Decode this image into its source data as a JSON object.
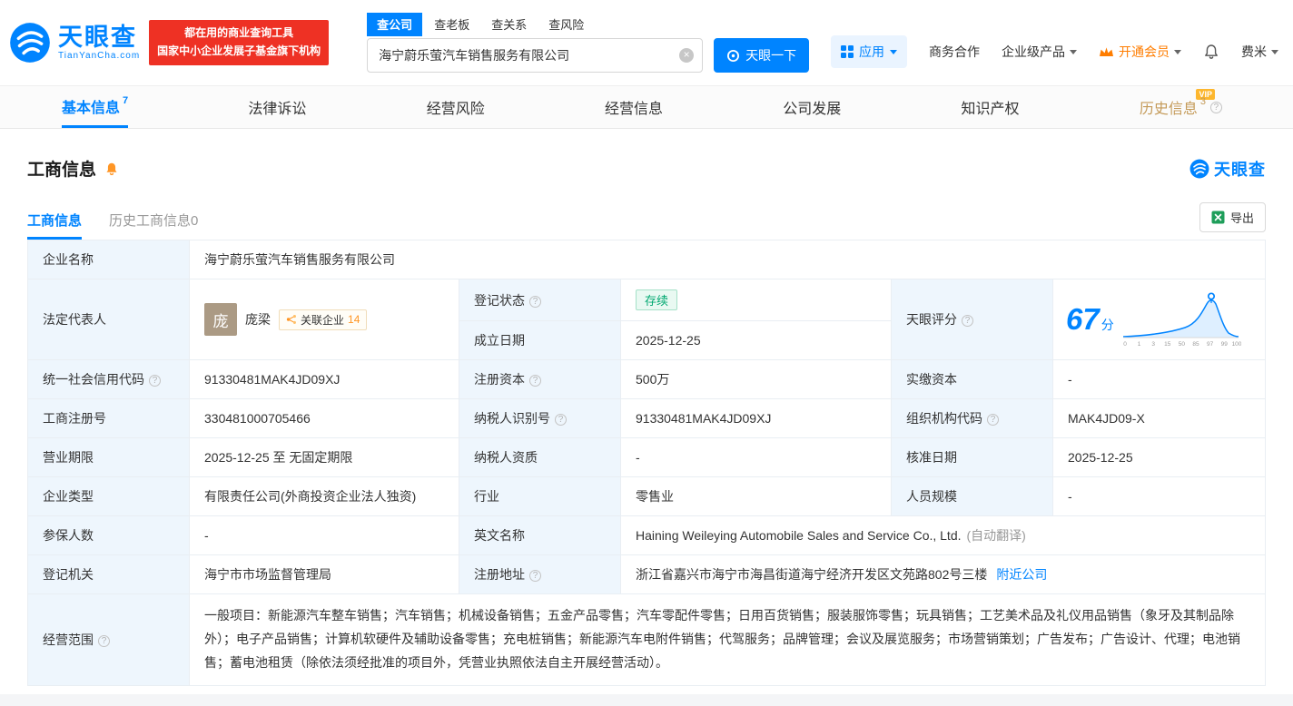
{
  "brand": {
    "name": "天眼查",
    "domain": "TianYanCha.com",
    "promo_line1": "都在用的商业查询工具",
    "promo_line2": "国家中小企业发展子基金旗下机构"
  },
  "search": {
    "tabs": [
      {
        "label": "查公司"
      },
      {
        "label": "查老板"
      },
      {
        "label": "查关系"
      },
      {
        "label": "查风险"
      }
    ],
    "value": "海宁蔚乐萤汽车销售服务有限公司",
    "button_label": "天眼一下"
  },
  "header_nav": {
    "app_label": "应用",
    "coop_label": "商务合作",
    "enterprise_label": "企业级产品",
    "vip_label": "开通会员",
    "user_name": "费米"
  },
  "nav_tabs": [
    {
      "label": "基本信息",
      "badge": "7"
    },
    {
      "label": "法律诉讼"
    },
    {
      "label": "经营风险"
    },
    {
      "label": "经营信息"
    },
    {
      "label": "公司发展"
    },
    {
      "label": "知识产权"
    },
    {
      "label": "历史信息",
      "badge": "3",
      "vip_tag": "VIP"
    }
  ],
  "section": {
    "title": "工商信息",
    "subtab_active": "工商信息",
    "subtab_history": "历史工商信息",
    "subtab_history_count": "0",
    "export_label": "导出",
    "watermark": "天眼查"
  },
  "fields": {
    "company_name": {
      "label": "企业名称",
      "value": "海宁蔚乐萤汽车销售服务有限公司"
    },
    "legal_rep": {
      "label": "法定代表人",
      "avatar_char": "庞",
      "name": "庞梁",
      "related_label": "关联企业",
      "related_count": "14"
    },
    "reg_status": {
      "label": "登记状态",
      "value": "存续"
    },
    "establish_date": {
      "label": "成立日期",
      "value": "2025-12-25"
    },
    "score": {
      "label": "天眼评分",
      "value": "67",
      "unit": "分"
    },
    "credit_code": {
      "label": "统一社会信用代码",
      "value": "91330481MAK4JD09XJ"
    },
    "reg_capital": {
      "label": "注册资本",
      "value": "500万"
    },
    "paid_capital": {
      "label": "实缴资本",
      "value": "-"
    },
    "reg_number": {
      "label": "工商注册号",
      "value": "330481000705466"
    },
    "taxpayer_id": {
      "label": "纳税人识别号",
      "value": "91330481MAK4JD09XJ"
    },
    "org_code": {
      "label": "组织机构代码",
      "value": "MAK4JD09-X"
    },
    "business_term": {
      "label": "营业期限",
      "value": "2025-12-25 至 无固定期限"
    },
    "taxpayer_qual": {
      "label": "纳税人资质",
      "value": "-"
    },
    "approval_date": {
      "label": "核准日期",
      "value": "2025-12-25"
    },
    "company_type": {
      "label": "企业类型",
      "value": "有限责任公司(外商投资企业法人独资)"
    },
    "industry": {
      "label": "行业",
      "value": "零售业"
    },
    "staff_size": {
      "label": "人员规模",
      "value": "-"
    },
    "insured_count": {
      "label": "参保人数",
      "value": "-"
    },
    "english_name": {
      "label": "英文名称",
      "value": "Haining Weileying Automobile Sales and Service Co., Ltd.",
      "note": "(自动翻译)"
    },
    "reg_authority": {
      "label": "登记机关",
      "value": "海宁市市场监督管理局"
    },
    "reg_address": {
      "label": "注册地址",
      "value": "浙江省嘉兴市海宁市海昌街道海宁经济开发区文苑路802号三楼",
      "link": "附近公司"
    },
    "business_scope": {
      "label": "经营范围",
      "value": "一般项目：新能源汽车整车销售；汽车销售；机械设备销售；五金产品零售；汽车零配件零售；日用百货销售；服装服饰零售；玩具销售；工艺美术品及礼仪用品销售（象牙及其制品除外）；电子产品销售；计算机软硬件及辅助设备零售；充电桩销售；新能源汽车电附件销售；代驾服务；品牌管理；会议及展览服务；市场营销策划；广告发布；广告设计、代理；电池销售；蓄电池租赁（除依法须经批准的项目外，凭营业执照依法自主开展经营活动）。"
    }
  },
  "score_chart": {
    "ticks": [
      "0",
      "1",
      "3",
      "15",
      "50",
      "85",
      "97",
      "99",
      "100"
    ]
  }
}
